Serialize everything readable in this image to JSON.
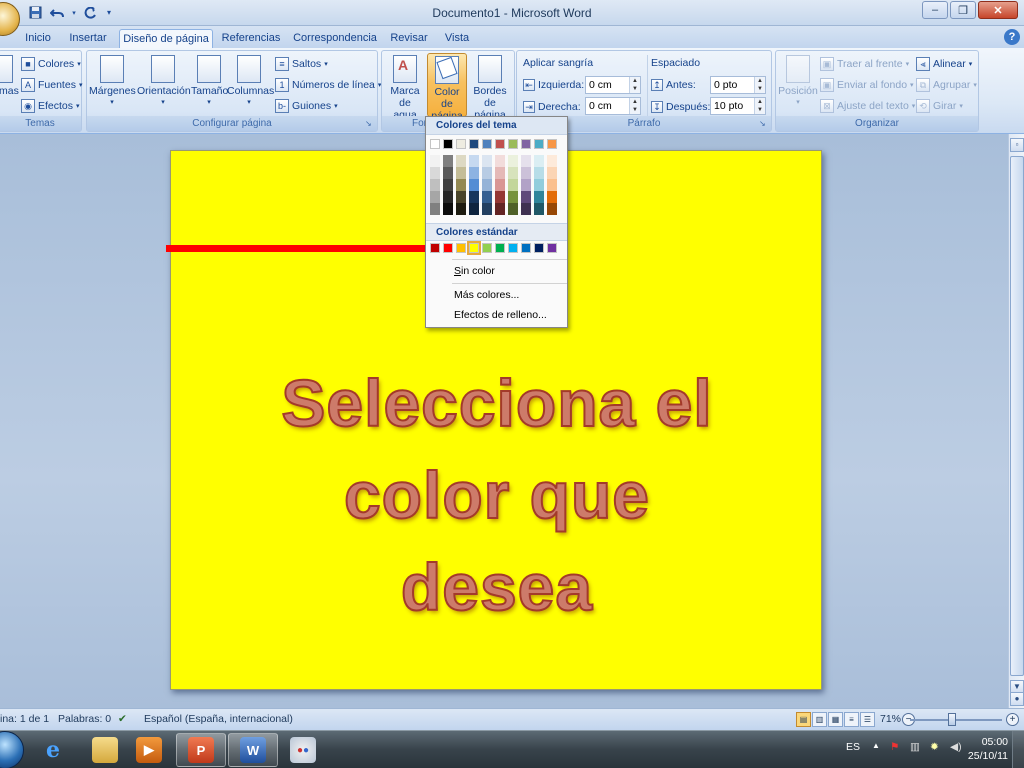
{
  "window": {
    "title": "Documento1 - Microsoft Word",
    "minimize": "–",
    "maximize": "❐",
    "close": "✕"
  },
  "qat": {
    "save_icon": "save-icon",
    "undo_icon": "undo-icon",
    "redo_icon": "redo-icon"
  },
  "tabs": [
    {
      "label": "Inicio"
    },
    {
      "label": "Insertar"
    },
    {
      "label": "Diseño de página"
    },
    {
      "label": "Referencias"
    },
    {
      "label": "Correspondencia"
    },
    {
      "label": "Revisar"
    },
    {
      "label": "Vista"
    }
  ],
  "ribbon": {
    "temas": {
      "label": "Temas",
      "themes_btn": "mas",
      "colores": "Colores",
      "fuentes": "Fuentes",
      "efectos": "Efectos"
    },
    "configurar": {
      "label": "Configurar página",
      "margenes": "Márgenes",
      "orientacion": "Orientación",
      "tamano": "Tamaño",
      "columnas": "Columnas",
      "saltos": "Saltos",
      "numeros": "Números de línea",
      "guiones": "Guiones"
    },
    "fondo": {
      "label": "Fon",
      "marca_1": "Marca de",
      "marca_2": "agua",
      "color_1": "Color de",
      "color_2": "página",
      "bordes_1": "Bordes",
      "bordes_2": "de página"
    },
    "parrafo": {
      "label": "Párrafo",
      "sangria": "Aplicar sangría",
      "izquierda": "Izquierda:",
      "izquierda_val": "0 cm",
      "derecha": "Derecha:",
      "derecha_val": "0 cm",
      "espaciado": "Espaciado",
      "antes": "Antes:",
      "antes_val": "0 pto",
      "despues": "Después:",
      "despues_val": "10 pto"
    },
    "organizar": {
      "label": "Organizar",
      "posicion": "Posición",
      "traer": "Traer al frente",
      "enviar": "Enviar al fondo",
      "ajuste": "Ajuste del texto",
      "alinear": "Alinear",
      "agrupar": "Agrupar",
      "girar": "Girar"
    }
  },
  "dropdown": {
    "theme_header": "Colores del tema",
    "standard_header": "Colores estándar",
    "theme_colors": [
      "#ffffff",
      "#000000",
      "#eeece1",
      "#1f497d",
      "#4f81bd",
      "#c0504d",
      "#9bbb59",
      "#8064a2",
      "#4bacc6",
      "#f79646"
    ],
    "theme_shades": [
      [
        "#f2f2f2",
        "#d9d9d9",
        "#bfbfbf",
        "#a6a6a6",
        "#808080"
      ],
      [
        "#7f7f7f",
        "#595959",
        "#3f3f3f",
        "#262626",
        "#0c0c0c"
      ],
      [
        "#ddd9c3",
        "#c4bd97",
        "#938953",
        "#494429",
        "#1d1b10"
      ],
      [
        "#c6d9f0",
        "#8db3e2",
        "#548dd4",
        "#17365d",
        "#0f243e"
      ],
      [
        "#dbe5f1",
        "#b8cce4",
        "#95b3d7",
        "#366092",
        "#244061"
      ],
      [
        "#f2dcdb",
        "#e5b9b7",
        "#d99694",
        "#953734",
        "#632423"
      ],
      [
        "#ebf1dd",
        "#d7e3bc",
        "#c3d69b",
        "#76923c",
        "#4f6128"
      ],
      [
        "#e5e0ec",
        "#ccc1d9",
        "#b2a2c7",
        "#5f497a",
        "#3f3151"
      ],
      [
        "#dbeef3",
        "#b7dde8",
        "#92cddc",
        "#31859b",
        "#205867"
      ],
      [
        "#fdeada",
        "#fbd5b5",
        "#fac08f",
        "#e36c09",
        "#974806"
      ]
    ],
    "standard_colors": [
      "#c00000",
      "#ff0000",
      "#ffc000",
      "#ffff00",
      "#92d050",
      "#00b050",
      "#00b0f0",
      "#0070c0",
      "#002060",
      "#7030a0"
    ],
    "selected_standard": "#ffff00",
    "sin_color_rest": "in color",
    "sin_color_mnemonic": "S",
    "mas_colores": "Más colores...",
    "efectos_relleno": "Efectos de relleno..."
  },
  "document": {
    "page_color": "#ffff00",
    "line1": "Selecciona el",
    "line2": "color que",
    "line3": "desea"
  },
  "statusbar": {
    "pagina": "ina: 1 de 1",
    "palabras": "Palabras: 0",
    "idioma": "Español (España, internacional)",
    "zoom": "71%",
    "zoom_level": 0.71
  },
  "taskbar": {
    "lang": "ES",
    "time": "05:00",
    "date": "25/10/11"
  },
  "colors": {
    "annotation_arrow": "#ff0000",
    "ribbon_accent": "#15428b"
  }
}
